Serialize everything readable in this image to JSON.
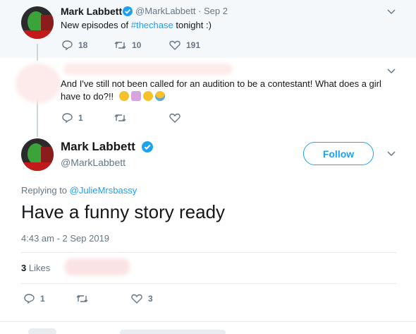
{
  "tweet1": {
    "name": "Mark Labbett",
    "handle_date": "@MarkLabbett · Sep 2",
    "text_prefix": "New episodes of ",
    "hashtag": "#thechase",
    "text_suffix": " tonight :)",
    "replies": "18",
    "retweets": "10",
    "likes": "191"
  },
  "tweet2": {
    "text_line1": "And I've still not been called for an audition to be a contestant! What does a girl",
    "text_line2": "have to do?!!",
    "emojis": [
      "thinking-face",
      "woman-shrugging",
      "winking-face-tongue",
      "face-with-tears-of-joy"
    ],
    "replies": "1"
  },
  "main": {
    "name": "Mark Labbett",
    "handle": "@MarkLabbett",
    "follow_label": "Follow",
    "replying_label": "Replying to ",
    "replying_handle": "@JulieMrsbassy",
    "text": "Have a funny story ready",
    "timestamp": "4:43 am - 2 Sep 2019",
    "likes_count": "3",
    "likes_label": "Likes",
    "replies": "1",
    "like_count": "3"
  },
  "colors": {
    "accent": "#1da1f2",
    "muted": "#657786",
    "bg_highlight": "#f5f8fa"
  }
}
